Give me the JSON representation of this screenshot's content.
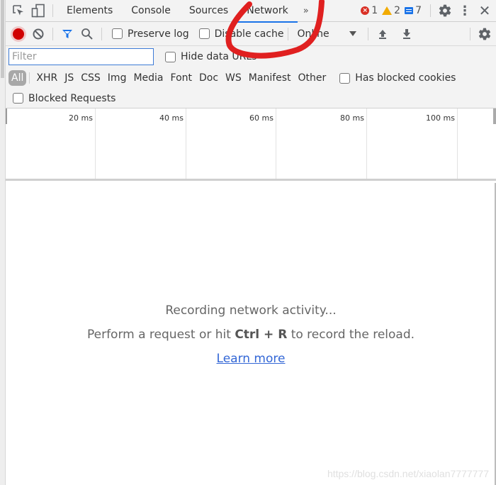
{
  "tabs": [
    {
      "label": "Elements",
      "active": false
    },
    {
      "label": "Console",
      "active": false
    },
    {
      "label": "Sources",
      "active": false
    },
    {
      "label": "Network",
      "active": true
    }
  ],
  "tab_more": "»",
  "badges": {
    "errors": "1",
    "warnings": "2",
    "messages": "7"
  },
  "toolbar": {
    "preserve_log": "Preserve log",
    "disable_cache": "Disable cache",
    "throttling": "Online"
  },
  "filter": {
    "placeholder": "Filter",
    "hide_data_urls": "Hide data URLs",
    "types": [
      "All",
      "XHR",
      "JS",
      "CSS",
      "Img",
      "Media",
      "Font",
      "Doc",
      "WS",
      "Manifest",
      "Other"
    ],
    "has_blocked_cookies": "Has blocked cookies",
    "blocked_requests": "Blocked Requests"
  },
  "timeline": {
    "ticks": [
      "20 ms",
      "40 ms",
      "60 ms",
      "80 ms",
      "100 ms"
    ]
  },
  "empty_state": {
    "line1": "Recording network activity...",
    "line2_pre": "Perform a request or hit ",
    "line2_key": "Ctrl + R",
    "line2_post": " to record the reload.",
    "link": "Learn more"
  },
  "watermark": "https://blog.csdn.net/xiaolan7777777",
  "colors": {
    "accent": "#1a73e8",
    "record": "#d00000",
    "annotation": "#e02020"
  }
}
